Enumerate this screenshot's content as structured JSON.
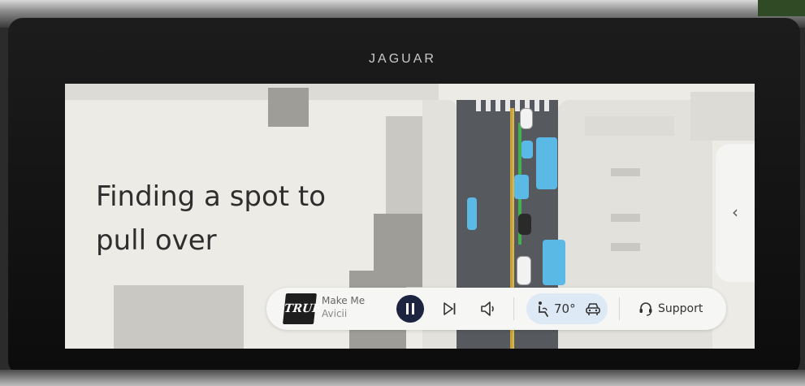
{
  "brand": "JAGUAR",
  "status": {
    "heading_line1": "Finding a spot to",
    "heading_line2": "pull over"
  },
  "media": {
    "album_art_text": "TRUE",
    "track_title": "Make Me",
    "track_artist": "Avicii",
    "play_state": "playing",
    "icons": {
      "pause": "pause-icon",
      "next": "skip-next-icon",
      "volume": "volume-icon"
    }
  },
  "climate": {
    "temperature": "70°",
    "icons": {
      "seat": "seat-icon",
      "vehicle": "car-icon"
    }
  },
  "support": {
    "label": "Support",
    "icon": "headset-icon"
  },
  "side_panel": {
    "icon": "chevron-left-icon",
    "glyph": "‹"
  },
  "colors": {
    "pause_button": "#1c2440",
    "climate_pill": "#dde9f4",
    "bus": "#5bb9e6",
    "road": "#56595d"
  }
}
